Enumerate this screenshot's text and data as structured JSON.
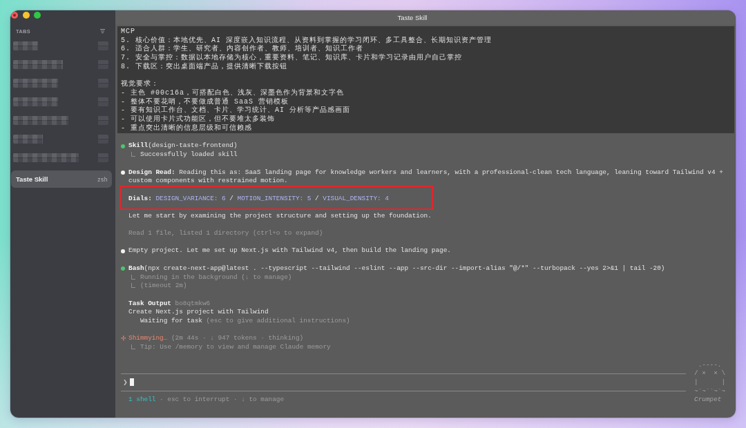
{
  "window": {
    "title": "Taste Skill"
  },
  "sidebar": {
    "heading": "TABS",
    "tabs": [
      {
        "kind": "redacted",
        "selected": false
      },
      {
        "kind": "redacted",
        "selected": false
      },
      {
        "kind": "redacted",
        "selected": false
      },
      {
        "kind": "redacted",
        "selected": false
      },
      {
        "kind": "redacted",
        "selected": false
      },
      {
        "kind": "redacted",
        "selected": false
      },
      {
        "kind": "redacted",
        "selected": false
      },
      {
        "kind": "tab",
        "title": "Taste Skill",
        "shell": "zsh",
        "selected": true
      }
    ]
  },
  "prompt_block": {
    "paragraphs": [
      [
        "MCP",
        "5. 核心价值：本地优先、AI 深度嵌入知识流程、从资料到掌握的学习闭环、多工具整合、长期知识资产管理",
        "6. 适合人群：学生、研究者、内容创作者、教师、培训者、知识工作者",
        "7. 安全与掌控：数据以本地存储为核心，重要资料、笔记、知识库、卡片和学习记录由用户自己掌控",
        "8. 下载区：突出桌面端产品，提供清晰下载按钮"
      ],
      [
        "视觉要求：",
        "- 主色 #00c16a，可搭配白色、浅灰、深墨色作为背景和文字色",
        "- 整体不要花哨，不要做成普通 SaaS 营销模板",
        "- 要有知识工作台、文档、卡片、学习统计、AI 分析等产品感画面",
        "- 可以使用卡片式功能区，但不要堆太多装饰",
        "- 重点突出清晰的信息层级和可信赖感"
      ]
    ]
  },
  "transcript": [
    {
      "kind": "tool",
      "tool": "Skill",
      "args": "(design-taste-frontend)",
      "results": [
        {
          "text": "Successfully loaded skill",
          "dim": false
        }
      ]
    },
    {
      "kind": "message",
      "text": "**Design Read:** Reading this as: SaaS landing page for knowledge workers and learners, with a professional-clean tech language, leaning toward Tailwind v4 + custom components with restrained motion."
    },
    {
      "kind": "dials",
      "label": "Dials:",
      "dials": [
        {
          "kind": "value",
          "text": "DESIGN_VARIANCE: 6"
        },
        {
          "kind": "separator",
          "text": "/"
        },
        {
          "kind": "value",
          "text": "MOTION_INTENSITY: 5"
        },
        {
          "kind": "separator",
          "text": "/"
        },
        {
          "kind": "value",
          "text": "VISUAL_DENSITY: 4"
        }
      ],
      "highlighted": true
    },
    {
      "kind": "text",
      "text": "Let me start by examining the project structure and setting up the foundation.",
      "dim": false
    },
    {
      "kind": "text",
      "text": "Read 1 file, listed 1 directory (ctrl+o to expand)",
      "dim": true
    },
    {
      "kind": "message",
      "text": "Empty project. Let me set up Next.js with Tailwind v4, then build the landing page."
    },
    {
      "kind": "tool",
      "tool": "Bash",
      "args": "(npx create-next-app@latest . --typescript --tailwind --eslint --app --src-dir --import-alias \"@/*\" --turbopack --yes 2>&1 | tail -20)",
      "results": [
        {
          "text": "Running in the background (↓ to manage)",
          "dim": true
        },
        {
          "text": "(timeout 2m)",
          "dim": true
        }
      ]
    },
    {
      "kind": "task",
      "label": "Task Output",
      "id": "bo8qtmkw6",
      "title": "Create Next.js project with Tailwind",
      "status": "Waiting for task",
      "hint": "(esc to give additional instructions)"
    },
    {
      "kind": "spinner",
      "glyph": "✢",
      "verb": "Shimmying…",
      "meta": "(2m 44s · ↓ 947 tokens · thinking)",
      "results": [
        {
          "text": "Tip: Use /memory to view and manage Claude memory",
          "dim": true
        }
      ]
    }
  ],
  "input": {
    "prompt": "❯"
  },
  "status_bar": {
    "shells": "1 shell",
    "hints": "· esc to interrupt · ↓ to manage"
  },
  "mascot": {
    "art": [
      " .----.",
      "/ ×  × \\",
      "|      |",
      "~`~``~`~"
    ],
    "name": "Crumpet"
  }
}
